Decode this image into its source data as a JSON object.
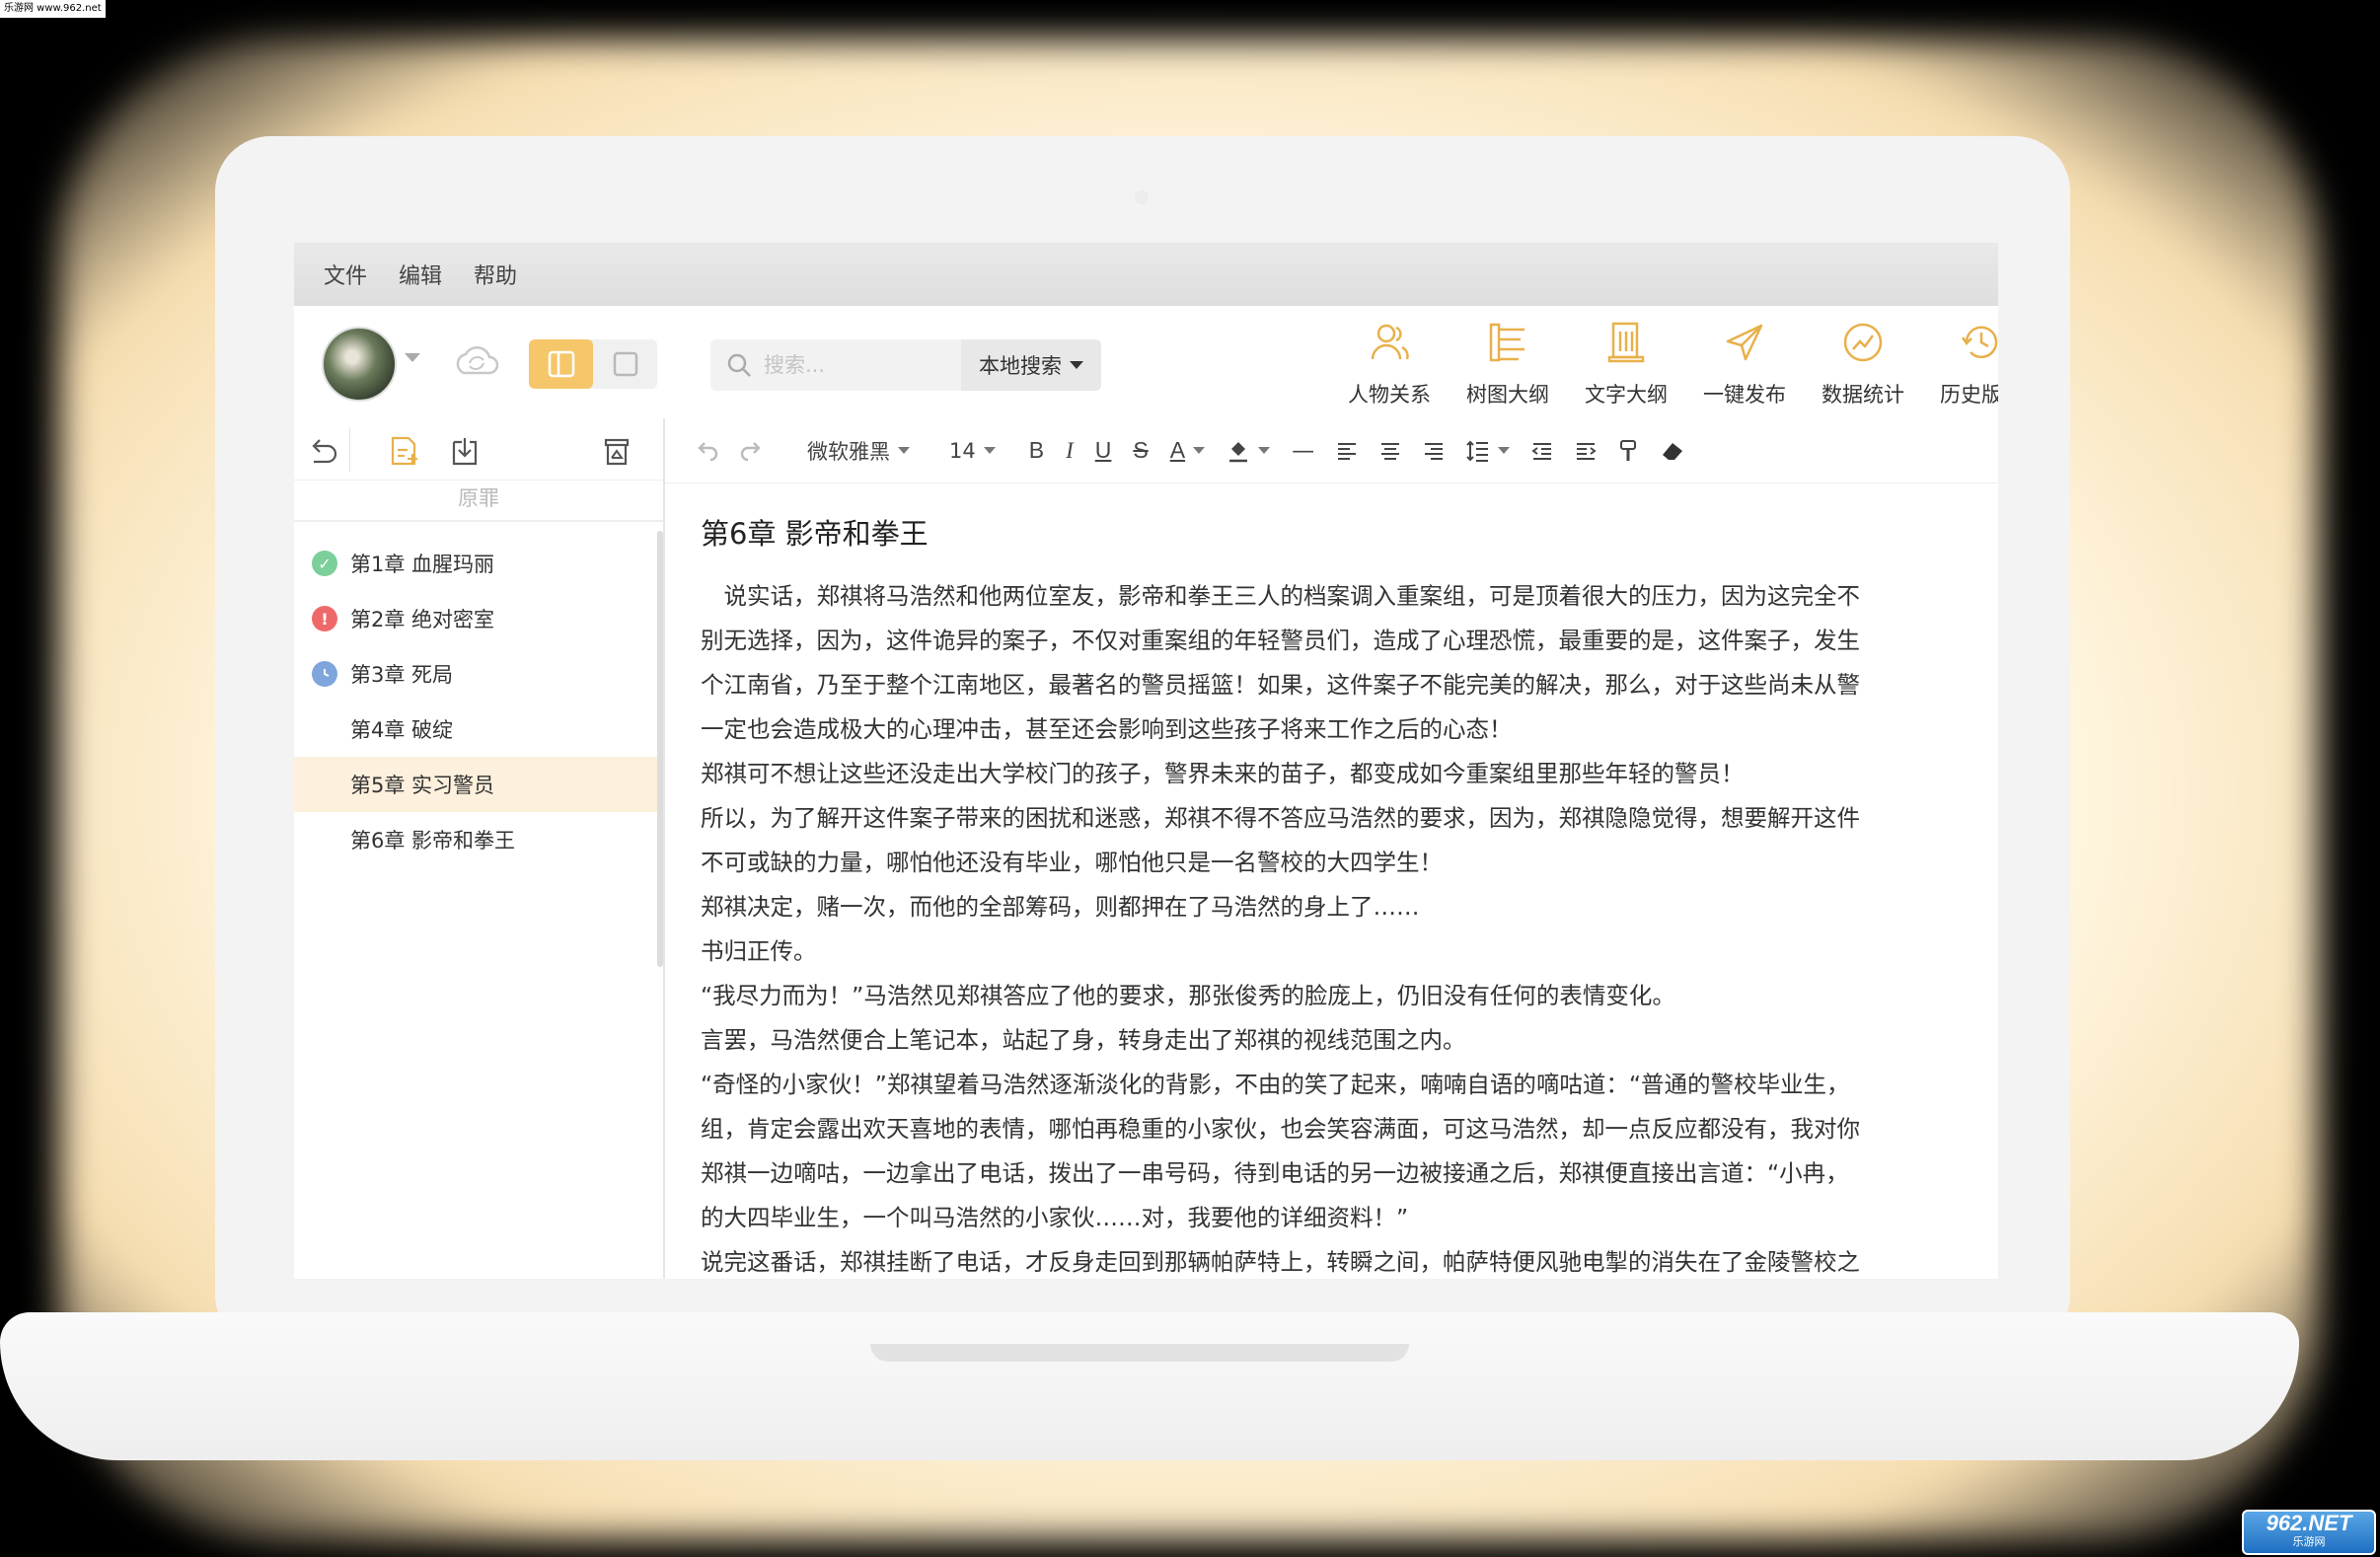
{
  "watermark": "乐游网 www.962.net",
  "site_logo": {
    "big": "962.NET",
    "small": "乐游网"
  },
  "menu": [
    "文件",
    "编辑",
    "帮助"
  ],
  "search": {
    "placeholder": "搜索...",
    "scope": "本地搜索"
  },
  "tools": [
    {
      "icon": "people-icon",
      "label": "人物关系"
    },
    {
      "icon": "tree-outline-icon",
      "label": "树图大纲"
    },
    {
      "icon": "text-outline-icon",
      "label": "文字大纲"
    },
    {
      "icon": "publish-icon",
      "label": "一键发布"
    },
    {
      "icon": "chart-icon",
      "label": "数据统计"
    },
    {
      "icon": "history-icon",
      "label": "历史版本"
    }
  ],
  "book_title": "原罪",
  "chapters": [
    {
      "label": "第1章 血腥玛丽",
      "status": "done",
      "status_color": "#7ccf9a"
    },
    {
      "label": "第2章 绝对密室",
      "status": "warning",
      "status_color": "#ee6a6a"
    },
    {
      "label": "第3章 死局",
      "status": "pending",
      "status_color": "#7fa6dc"
    },
    {
      "label": "第4章 破绽",
      "status": "none"
    },
    {
      "label": "第5章 实习警员",
      "status": "none",
      "selected": true
    },
    {
      "label": "第6章 影帝和拳王",
      "status": "none"
    }
  ],
  "format_bar": {
    "font": "微软雅黑",
    "size": "14"
  },
  "document": {
    "title": "第6章  影帝和拳王",
    "paragraphs": [
      "　说实话，郑祺将马浩然和他两位室友，影帝和拳王三人的档案调入重案组，可是顶着很大的压力，因为这完全不",
      "别无选择，因为，这件诡异的案子，不仅对重案组的年轻警员们，造成了心理恐慌，最重要的是，这件案子，发生",
      "个江南省，乃至于整个江南地区，最著名的警员摇篮！如果，这件案子不能完美的解决，那么，对于这些尚未从警",
      "一定也会造成极大的心理冲击，甚至还会影响到这些孩子将来工作之后的心态！",
      "郑祺可不想让这些还没走出大学校门的孩子，警界未来的苗子，都变成如今重案组里那些年轻的警员！",
      "所以，为了解开这件案子带来的困扰和迷惑，郑祺不得不答应马浩然的要求，因为，郑祺隐隐觉得，想要解开这件",
      "不可或缺的力量，哪怕他还没有毕业，哪怕他只是一名警校的大四学生！",
      "郑祺决定，赌一次，而他的全部筹码，则都押在了马浩然的身上了……",
      "书归正传。",
      "“我尽力而为！”马浩然见郑祺答应了他的要求，那张俊秀的脸庞上，仍旧没有任何的表情变化。",
      "言罢，马浩然便合上笔记本，站起了身，转身走出了郑祺的视线范围之内。",
      "“奇怪的小家伙！”郑祺望着马浩然逐渐淡化的背影，不由的笑了起来，喃喃自语的嘀咕道：“普通的警校毕业生，",
      "组，肯定会露出欢天喜地的表情，哪怕再稳重的小家伙，也会笑容满面，可这马浩然，却一点反应都没有，我对你",
      "郑祺一边嘀咕，一边拿出了电话，拨出了一串号码，待到电话的另一边被接通之后，郑祺便直接出言道：“小冉，",
      "的大四毕业生，一个叫马浩然的小家伙……对，我要他的详细资料！”",
      "说完这番话，郑祺挂断了电话，才反身走回到那辆帕萨特上，转瞬之间，帕萨特便风驰电掣的消失在了金陵警校之"
    ]
  },
  "colors": {
    "accent": "#e8b04b",
    "selected_row": "#fdf0dc"
  }
}
